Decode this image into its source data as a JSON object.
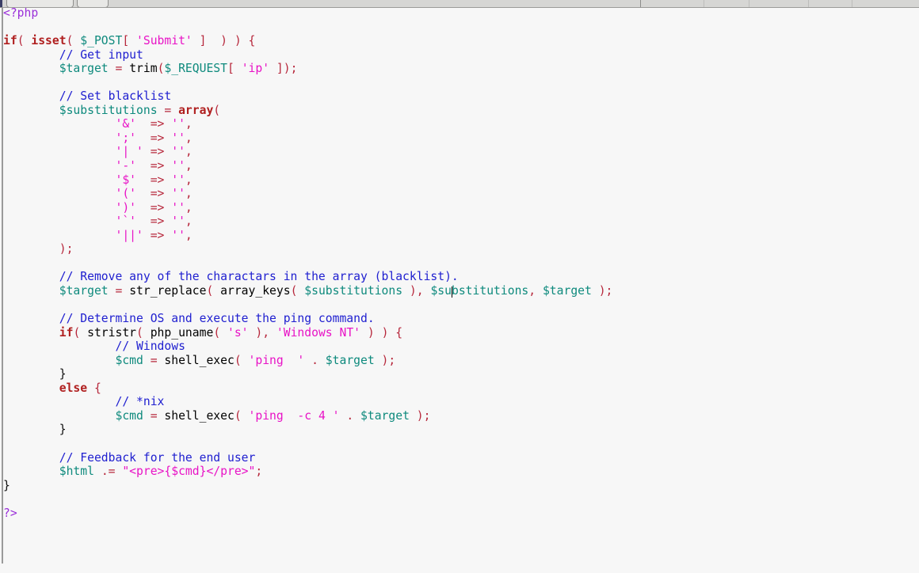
{
  "window": {
    "chrome_strip": {
      "pills": [
        "toolbar-button-wide",
        "toolbar-button-small"
      ],
      "divider_count": 5,
      "background_color": "#d6d6d4",
      "accent_color": "#3b3f66"
    }
  },
  "code_view": {
    "language": "php",
    "background_color": "#f7f7f7",
    "caret_visible": true,
    "caret_line": 22,
    "caret_after_text": "$su",
    "palette": {
      "tag": "#9b30d9",
      "keyword": "#b02020",
      "variable": "#0e8a7d",
      "string": "#e813c6",
      "punctuation": "#b7283c",
      "comment": "#2020d0",
      "plain": "#111111"
    },
    "lines": [
      {
        "n": 1,
        "tokens": [
          {
            "t": "tag",
            "v": "<?php"
          }
        ]
      },
      {
        "n": 2,
        "tokens": []
      },
      {
        "n": 3,
        "tokens": [
          {
            "t": "kw",
            "v": "if"
          },
          {
            "t": "punct",
            "v": "("
          },
          {
            "t": "plain",
            "v": " "
          },
          {
            "t": "kw",
            "v": "isset"
          },
          {
            "t": "punct",
            "v": "("
          },
          {
            "t": "plain",
            "v": " "
          },
          {
            "t": "var",
            "v": "$_POST"
          },
          {
            "t": "punct",
            "v": "["
          },
          {
            "t": "plain",
            "v": " "
          },
          {
            "t": "str",
            "v": "'Submit'"
          },
          {
            "t": "plain",
            "v": " "
          },
          {
            "t": "punct",
            "v": "]"
          },
          {
            "t": "plain",
            "v": "  "
          },
          {
            "t": "punct",
            "v": ")"
          },
          {
            "t": "plain",
            "v": " "
          },
          {
            "t": "punct",
            "v": ")"
          },
          {
            "t": "plain",
            "v": " "
          },
          {
            "t": "punct",
            "v": "{"
          }
        ]
      },
      {
        "n": 4,
        "tokens": [
          {
            "t": "indent",
            "v": 1
          },
          {
            "t": "cmt",
            "v": "// Get input"
          }
        ]
      },
      {
        "n": 5,
        "tokens": [
          {
            "t": "indent",
            "v": 1
          },
          {
            "t": "var",
            "v": "$target"
          },
          {
            "t": "plain",
            "v": " "
          },
          {
            "t": "punct",
            "v": "="
          },
          {
            "t": "plain",
            "v": " "
          },
          {
            "t": "fn",
            "v": "trim"
          },
          {
            "t": "punct",
            "v": "("
          },
          {
            "t": "var",
            "v": "$_REQUEST"
          },
          {
            "t": "punct",
            "v": "["
          },
          {
            "t": "plain",
            "v": " "
          },
          {
            "t": "str",
            "v": "'ip'"
          },
          {
            "t": "plain",
            "v": " "
          },
          {
            "t": "punct",
            "v": "]);"
          }
        ]
      },
      {
        "n": 6,
        "tokens": []
      },
      {
        "n": 7,
        "tokens": [
          {
            "t": "indent",
            "v": 1
          },
          {
            "t": "cmt",
            "v": "// Set blacklist"
          }
        ]
      },
      {
        "n": 8,
        "tokens": [
          {
            "t": "indent",
            "v": 1
          },
          {
            "t": "var",
            "v": "$substitutions"
          },
          {
            "t": "plain",
            "v": " "
          },
          {
            "t": "punct",
            "v": "="
          },
          {
            "t": "plain",
            "v": " "
          },
          {
            "t": "kw",
            "v": "array"
          },
          {
            "t": "punct",
            "v": "("
          }
        ]
      },
      {
        "n": 9,
        "tokens": [
          {
            "t": "indent",
            "v": 2
          },
          {
            "t": "str",
            "v": "'&'"
          },
          {
            "t": "plain",
            "v": "  "
          },
          {
            "t": "punct",
            "v": "=>"
          },
          {
            "t": "plain",
            "v": " "
          },
          {
            "t": "str",
            "v": "''"
          },
          {
            "t": "punct",
            "v": ","
          }
        ]
      },
      {
        "n": 10,
        "tokens": [
          {
            "t": "indent",
            "v": 2
          },
          {
            "t": "str",
            "v": "';'"
          },
          {
            "t": "plain",
            "v": "  "
          },
          {
            "t": "punct",
            "v": "=>"
          },
          {
            "t": "plain",
            "v": " "
          },
          {
            "t": "str",
            "v": "''"
          },
          {
            "t": "punct",
            "v": ","
          }
        ]
      },
      {
        "n": 11,
        "tokens": [
          {
            "t": "indent",
            "v": 2
          },
          {
            "t": "str",
            "v": "'| '"
          },
          {
            "t": "plain",
            "v": " "
          },
          {
            "t": "punct",
            "v": "=>"
          },
          {
            "t": "plain",
            "v": " "
          },
          {
            "t": "str",
            "v": "''"
          },
          {
            "t": "punct",
            "v": ","
          }
        ]
      },
      {
        "n": 12,
        "tokens": [
          {
            "t": "indent",
            "v": 2
          },
          {
            "t": "str",
            "v": "'-'"
          },
          {
            "t": "plain",
            "v": "  "
          },
          {
            "t": "punct",
            "v": "=>"
          },
          {
            "t": "plain",
            "v": " "
          },
          {
            "t": "str",
            "v": "''"
          },
          {
            "t": "punct",
            "v": ","
          }
        ]
      },
      {
        "n": 13,
        "tokens": [
          {
            "t": "indent",
            "v": 2
          },
          {
            "t": "str",
            "v": "'$'"
          },
          {
            "t": "plain",
            "v": "  "
          },
          {
            "t": "punct",
            "v": "=>"
          },
          {
            "t": "plain",
            "v": " "
          },
          {
            "t": "str",
            "v": "''"
          },
          {
            "t": "punct",
            "v": ","
          }
        ]
      },
      {
        "n": 14,
        "tokens": [
          {
            "t": "indent",
            "v": 2
          },
          {
            "t": "str",
            "v": "'('"
          },
          {
            "t": "plain",
            "v": "  "
          },
          {
            "t": "punct",
            "v": "=>"
          },
          {
            "t": "plain",
            "v": " "
          },
          {
            "t": "str",
            "v": "''"
          },
          {
            "t": "punct",
            "v": ","
          }
        ]
      },
      {
        "n": 15,
        "tokens": [
          {
            "t": "indent",
            "v": 2
          },
          {
            "t": "str",
            "v": "')'"
          },
          {
            "t": "plain",
            "v": "  "
          },
          {
            "t": "punct",
            "v": "=>"
          },
          {
            "t": "plain",
            "v": " "
          },
          {
            "t": "str",
            "v": "''"
          },
          {
            "t": "punct",
            "v": ","
          }
        ]
      },
      {
        "n": 16,
        "tokens": [
          {
            "t": "indent",
            "v": 2
          },
          {
            "t": "str",
            "v": "'`'"
          },
          {
            "t": "plain",
            "v": "  "
          },
          {
            "t": "punct",
            "v": "=>"
          },
          {
            "t": "plain",
            "v": " "
          },
          {
            "t": "str",
            "v": "''"
          },
          {
            "t": "punct",
            "v": ","
          }
        ]
      },
      {
        "n": 17,
        "tokens": [
          {
            "t": "indent",
            "v": 2
          },
          {
            "t": "str",
            "v": "'||'"
          },
          {
            "t": "plain",
            "v": " "
          },
          {
            "t": "punct",
            "v": "=>"
          },
          {
            "t": "plain",
            "v": " "
          },
          {
            "t": "str",
            "v": "''"
          },
          {
            "t": "punct",
            "v": ","
          }
        ]
      },
      {
        "n": 18,
        "tokens": [
          {
            "t": "indent",
            "v": 1
          },
          {
            "t": "punct",
            "v": ");"
          }
        ]
      },
      {
        "n": 19,
        "tokens": []
      },
      {
        "n": 20,
        "tokens": [
          {
            "t": "indent",
            "v": 1
          },
          {
            "t": "cmt",
            "v": "// Remove any of the charactars in the array (blacklist)."
          }
        ]
      },
      {
        "n": 21,
        "tokens": [
          {
            "t": "indent",
            "v": 1
          },
          {
            "t": "var",
            "v": "$target"
          },
          {
            "t": "plain",
            "v": " "
          },
          {
            "t": "punct",
            "v": "="
          },
          {
            "t": "plain",
            "v": " "
          },
          {
            "t": "fn",
            "v": "str_replace"
          },
          {
            "t": "punct",
            "v": "("
          },
          {
            "t": "plain",
            "v": " "
          },
          {
            "t": "fn",
            "v": "array_keys"
          },
          {
            "t": "punct",
            "v": "("
          },
          {
            "t": "plain",
            "v": " "
          },
          {
            "t": "var",
            "v": "$substitutions"
          },
          {
            "t": "plain",
            "v": " "
          },
          {
            "t": "punct",
            "v": "),"
          },
          {
            "t": "plain",
            "v": " "
          },
          {
            "t": "var",
            "v": "$su"
          },
          {
            "t": "caret",
            "v": ""
          },
          {
            "t": "var",
            "v": "bstitutions"
          },
          {
            "t": "punct",
            "v": ","
          },
          {
            "t": "plain",
            "v": " "
          },
          {
            "t": "var",
            "v": "$target"
          },
          {
            "t": "plain",
            "v": " "
          },
          {
            "t": "punct",
            "v": ");"
          }
        ]
      },
      {
        "n": 22,
        "tokens": []
      },
      {
        "n": 23,
        "tokens": [
          {
            "t": "indent",
            "v": 1
          },
          {
            "t": "cmt",
            "v": "// Determine OS and execute the ping command."
          }
        ]
      },
      {
        "n": 24,
        "tokens": [
          {
            "t": "indent",
            "v": 1
          },
          {
            "t": "kw",
            "v": "if"
          },
          {
            "t": "punct",
            "v": "("
          },
          {
            "t": "plain",
            "v": " "
          },
          {
            "t": "fn",
            "v": "stristr"
          },
          {
            "t": "punct",
            "v": "("
          },
          {
            "t": "plain",
            "v": " "
          },
          {
            "t": "fn",
            "v": "php_uname"
          },
          {
            "t": "punct",
            "v": "("
          },
          {
            "t": "plain",
            "v": " "
          },
          {
            "t": "str",
            "v": "'s'"
          },
          {
            "t": "plain",
            "v": " "
          },
          {
            "t": "punct",
            "v": "),"
          },
          {
            "t": "plain",
            "v": " "
          },
          {
            "t": "str",
            "v": "'Windows NT'"
          },
          {
            "t": "plain",
            "v": " "
          },
          {
            "t": "punct",
            "v": ")"
          },
          {
            "t": "plain",
            "v": " "
          },
          {
            "t": "punct",
            "v": ")"
          },
          {
            "t": "plain",
            "v": " "
          },
          {
            "t": "punct",
            "v": "{"
          }
        ]
      },
      {
        "n": 25,
        "tokens": [
          {
            "t": "indent",
            "v": 2
          },
          {
            "t": "cmt",
            "v": "// Windows"
          }
        ]
      },
      {
        "n": 26,
        "tokens": [
          {
            "t": "indent",
            "v": 2
          },
          {
            "t": "var",
            "v": "$cmd"
          },
          {
            "t": "plain",
            "v": " "
          },
          {
            "t": "punct",
            "v": "="
          },
          {
            "t": "plain",
            "v": " "
          },
          {
            "t": "fn",
            "v": "shell_exec"
          },
          {
            "t": "punct",
            "v": "("
          },
          {
            "t": "plain",
            "v": " "
          },
          {
            "t": "str",
            "v": "'ping  '"
          },
          {
            "t": "plain",
            "v": " "
          },
          {
            "t": "punct",
            "v": "."
          },
          {
            "t": "plain",
            "v": " "
          },
          {
            "t": "var",
            "v": "$target"
          },
          {
            "t": "plain",
            "v": " "
          },
          {
            "t": "punct",
            "v": ");"
          }
        ]
      },
      {
        "n": 27,
        "tokens": [
          {
            "t": "indent",
            "v": 1
          },
          {
            "t": "plain",
            "v": "}"
          }
        ]
      },
      {
        "n": 28,
        "tokens": [
          {
            "t": "indent",
            "v": 1
          },
          {
            "t": "kw",
            "v": "else"
          },
          {
            "t": "plain",
            "v": " "
          },
          {
            "t": "punct",
            "v": "{"
          }
        ]
      },
      {
        "n": 29,
        "tokens": [
          {
            "t": "indent",
            "v": 2
          },
          {
            "t": "cmt",
            "v": "// *nix"
          }
        ]
      },
      {
        "n": 30,
        "tokens": [
          {
            "t": "indent",
            "v": 2
          },
          {
            "t": "var",
            "v": "$cmd"
          },
          {
            "t": "plain",
            "v": " "
          },
          {
            "t": "punct",
            "v": "="
          },
          {
            "t": "plain",
            "v": " "
          },
          {
            "t": "fn",
            "v": "shell_exec"
          },
          {
            "t": "punct",
            "v": "("
          },
          {
            "t": "plain",
            "v": " "
          },
          {
            "t": "str",
            "v": "'ping  -c 4 '"
          },
          {
            "t": "plain",
            "v": " "
          },
          {
            "t": "punct",
            "v": "."
          },
          {
            "t": "plain",
            "v": " "
          },
          {
            "t": "var",
            "v": "$target"
          },
          {
            "t": "plain",
            "v": " "
          },
          {
            "t": "punct",
            "v": ");"
          }
        ]
      },
      {
        "n": 31,
        "tokens": [
          {
            "t": "indent",
            "v": 1
          },
          {
            "t": "plain",
            "v": "}"
          }
        ]
      },
      {
        "n": 32,
        "tokens": []
      },
      {
        "n": 33,
        "tokens": [
          {
            "t": "indent",
            "v": 1
          },
          {
            "t": "cmt",
            "v": "// Feedback for the end user"
          }
        ]
      },
      {
        "n": 34,
        "tokens": [
          {
            "t": "indent",
            "v": 1
          },
          {
            "t": "var",
            "v": "$html"
          },
          {
            "t": "plain",
            "v": " "
          },
          {
            "t": "punct",
            "v": ".="
          },
          {
            "t": "plain",
            "v": " "
          },
          {
            "t": "str",
            "v": "\"<pre>{$cmd}</pre>\""
          },
          {
            "t": "punct",
            "v": ";"
          }
        ]
      },
      {
        "n": 35,
        "tokens": [
          {
            "t": "plain",
            "v": "}"
          }
        ]
      },
      {
        "n": 36,
        "tokens": []
      },
      {
        "n": 37,
        "tokens": [
          {
            "t": "tag",
            "v": "?>"
          }
        ]
      }
    ]
  }
}
